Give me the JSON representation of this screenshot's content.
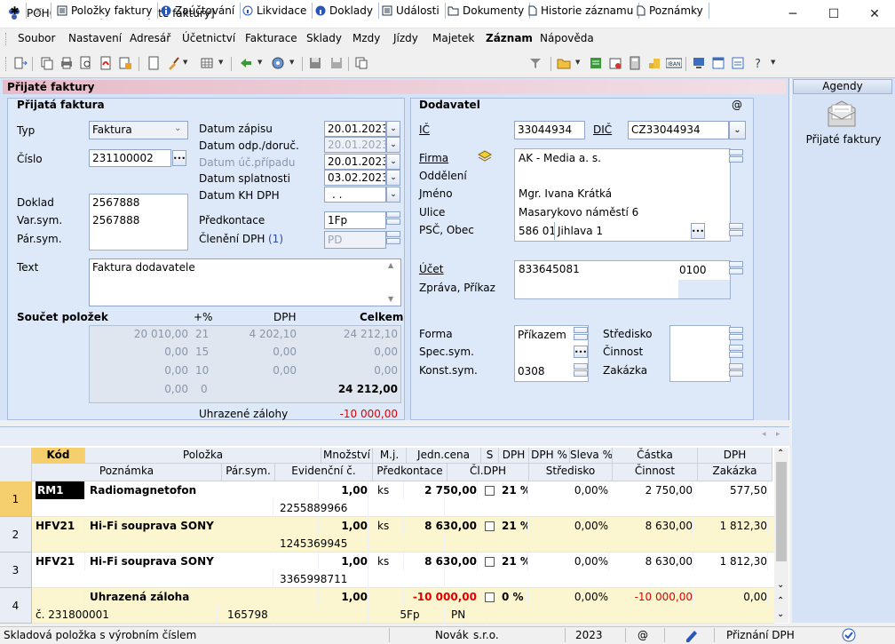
{
  "window": {
    "title": "POHODA Komplet - [Přijaté faktury]"
  },
  "menu": [
    "Soubor",
    "Nastavení",
    "Adresář",
    "Účetnictví",
    "Fakturace",
    "Sklady",
    "Mzdy",
    "Jízdy",
    "Majetek",
    "Záznam",
    "Nápověda"
  ],
  "form": {
    "header": "Přijaté faktury",
    "section_invoice": "Přijatá faktura",
    "typ_label": "Typ",
    "typ_value": "Faktura",
    "cislo_label": "Číslo",
    "cislo_value": "231100002",
    "datum_zapisu_label": "Datum zápisu",
    "datum_zapisu": "20.01.2023",
    "datum_odp_label": "Datum odp./doruč.",
    "datum_odp": "20.01.2023",
    "datum_uc_label": "Datum úč.případu",
    "datum_uc": "20.01.2023",
    "datum_splatnosti_label": "Datum splatnosti",
    "datum_splatnosti": "03.02.2023",
    "datum_kh_label": "Datum KH DPH",
    "datum_kh": ". .",
    "doklad_label": "Doklad",
    "doklad": "2567888",
    "varsym_label": "Var.sym.",
    "varsym": "2567888",
    "parsym_label": "Pár.sym.",
    "predkontace_label": "Předkontace",
    "predkontace": "1Fp",
    "cleneni_label": "Členění DPH",
    "cleneni_count": "(1)",
    "cleneni": "PD",
    "text_label": "Text",
    "text": "Faktura dodavatele",
    "soucet_label": "Součet položek",
    "pct_label": "+%",
    "dph_label": "DPH",
    "celkem_label": "Celkem",
    "sum_rows": [
      {
        "base": "20 010,00",
        "pct": "21",
        "dph": "4 202,10",
        "total": "24 212,10"
      },
      {
        "base": "0,00",
        "pct": "15",
        "dph": "0,00",
        "total": "0,00"
      },
      {
        "base": "0,00",
        "pct": "10",
        "dph": "0,00",
        "total": "0,00"
      },
      {
        "base": "0,00",
        "pct": "0",
        "dph": "",
        "total": "24 212,00"
      }
    ],
    "zalohy_label": "Uhrazené zálohy",
    "zalohy": "-10 000,00"
  },
  "supplier": {
    "section": "Dodavatel",
    "at": "@",
    "ic_label": "IČ",
    "ic": "33044934",
    "dic_label": "DIČ",
    "dic": "CZ33044934",
    "firma_label": "Firma",
    "firma": "AK - Media a. s.",
    "oddeleni_label": "Oddělení",
    "jmeno_label": "Jméno",
    "jmeno": "Mgr. Ivana Krátká",
    "ulice_label": "Ulice",
    "ulice": "Masarykovo náměstí 6",
    "psc_label": "PSČ, Obec",
    "psc": "586 01",
    "obec": "Jihlava 1",
    "ucet_label": "Účet",
    "ucet": "833645081",
    "kod_banky": "0100",
    "zprava_label": "Zpráva, Příkaz",
    "forma_label": "Forma",
    "forma": "Příkazem",
    "specsym_label": "Spec.sym.",
    "konstsym_label": "Konst.sym.",
    "konstsym": "0308",
    "stredisko_label": "Středisko",
    "cinnost_label": "Činnost",
    "zakazka_label": "Zakázka"
  },
  "agenda": {
    "title": "Agendy",
    "item": "Přijaté faktury"
  },
  "tabs": [
    "Položky faktury",
    "Zaúčtování",
    "Likvidace",
    "Doklady",
    "Události",
    "Dokumenty",
    "Historie záznamu",
    "Poznámky"
  ],
  "grid": {
    "headers1": [
      "Kód",
      "Položka",
      "Množství",
      "M.j.",
      "Jedn.cena",
      "S",
      "DPH",
      "DPH %",
      "Sleva %",
      "Částka",
      "DPH"
    ],
    "headers2": [
      "Poznámka",
      "Pár.sym.",
      "Evidenční č.",
      "Předkontace",
      "Čl.DPH",
      "Středisko",
      "Činnost",
      "Zakázka"
    ],
    "rows": [
      {
        "n": "1",
        "kod": "RM1",
        "polozka": "Radiomagnetofon",
        "mnozstvi": "1,00",
        "mj": "ks",
        "cena": "2 750,00",
        "dph": "21 %",
        "sleva": "0,00%",
        "castka": "2 750,00",
        "dphv": "577,50",
        "evid": "2255889966",
        "parsym": "",
        "predk": "",
        "red": false
      },
      {
        "n": "2",
        "kod": "HFV21",
        "polozka": "Hi-Fi souprava SONY",
        "mnozstvi": "1,00",
        "mj": "ks",
        "cena": "8 630,00",
        "dph": "21 %",
        "sleva": "0,00%",
        "castka": "8 630,00",
        "dphv": "1 812,30",
        "evid": "1245369945",
        "parsym": "",
        "predk": "",
        "red": false
      },
      {
        "n": "3",
        "kod": "HFV21",
        "polozka": "Hi-Fi souprava SONY",
        "mnozstvi": "1,00",
        "mj": "ks",
        "cena": "8 630,00",
        "dph": "21 %",
        "sleva": "0,00%",
        "castka": "8 630,00",
        "dphv": "1 812,30",
        "evid": "3365998711",
        "parsym": "",
        "predk": "",
        "red": false
      },
      {
        "n": "4",
        "kod": "",
        "polozka": "Uhrazená záloha",
        "mnozstvi": "1,00",
        "mj": "",
        "cena": "-10 000,00",
        "dph": "0 %",
        "sleva": "0,00%",
        "castka": "-10 000,00",
        "dphv": "0,00",
        "evid": "",
        "parsym": "165798",
        "predk": "5Fp",
        "poznamka": "č. 231800001",
        "cldph": "PN",
        "red": true
      }
    ]
  },
  "status": {
    "hint": "Skladová položka s výrobním číslem",
    "user": "Novák",
    "company": "s.r.o.",
    "year": "2023",
    "at": "@",
    "dph": "Přiznání DPH"
  }
}
